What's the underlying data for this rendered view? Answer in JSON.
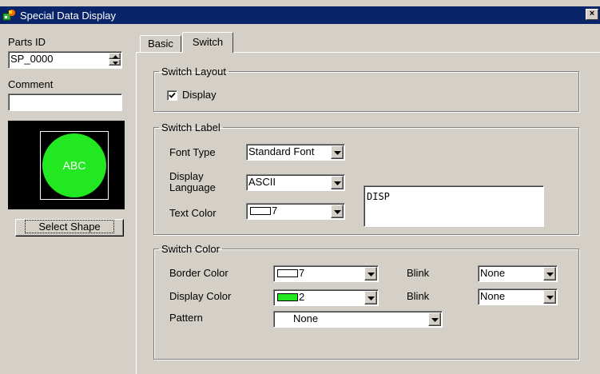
{
  "window": {
    "title": "Special Data Display",
    "close_label": "×"
  },
  "left": {
    "parts_id_label": "Parts ID",
    "parts_id_value": "SP_0000",
    "comment_label": "Comment",
    "comment_value": "",
    "preview_text": "ABC",
    "preview_color": "#22e822",
    "select_shape_label": "Select Shape"
  },
  "tabs": [
    {
      "label": "Basic",
      "active": false
    },
    {
      "label": "Switch",
      "active": true
    }
  ],
  "switch_layout": {
    "legend": "Switch Layout",
    "display_label": "Display",
    "display_checked": true
  },
  "switch_label": {
    "legend": "Switch Label",
    "font_type_label": "Font Type",
    "font_type_value": "Standard Font",
    "display_language_label_1": "Display",
    "display_language_label_2": "Language",
    "display_language_value": "ASCII",
    "text_color_label": "Text Color",
    "text_color_value": "7",
    "text_color_swatch": "#ffffff",
    "label_text": "DISP"
  },
  "switch_color": {
    "legend": "Switch Color",
    "border_color_label": "Border Color",
    "border_color_value": "7",
    "border_color_swatch": "#ffffff",
    "display_color_label": "Display Color",
    "display_color_value": "2",
    "display_color_swatch": "#22e822",
    "pattern_label": "Pattern",
    "pattern_value": "None",
    "blink_label_1": "Blink",
    "blink_value_1": "None",
    "blink_label_2": "Blink",
    "blink_value_2": "None"
  },
  "colors": {
    "titlebar": "#0a246a",
    "face": "#d4d0c8"
  }
}
